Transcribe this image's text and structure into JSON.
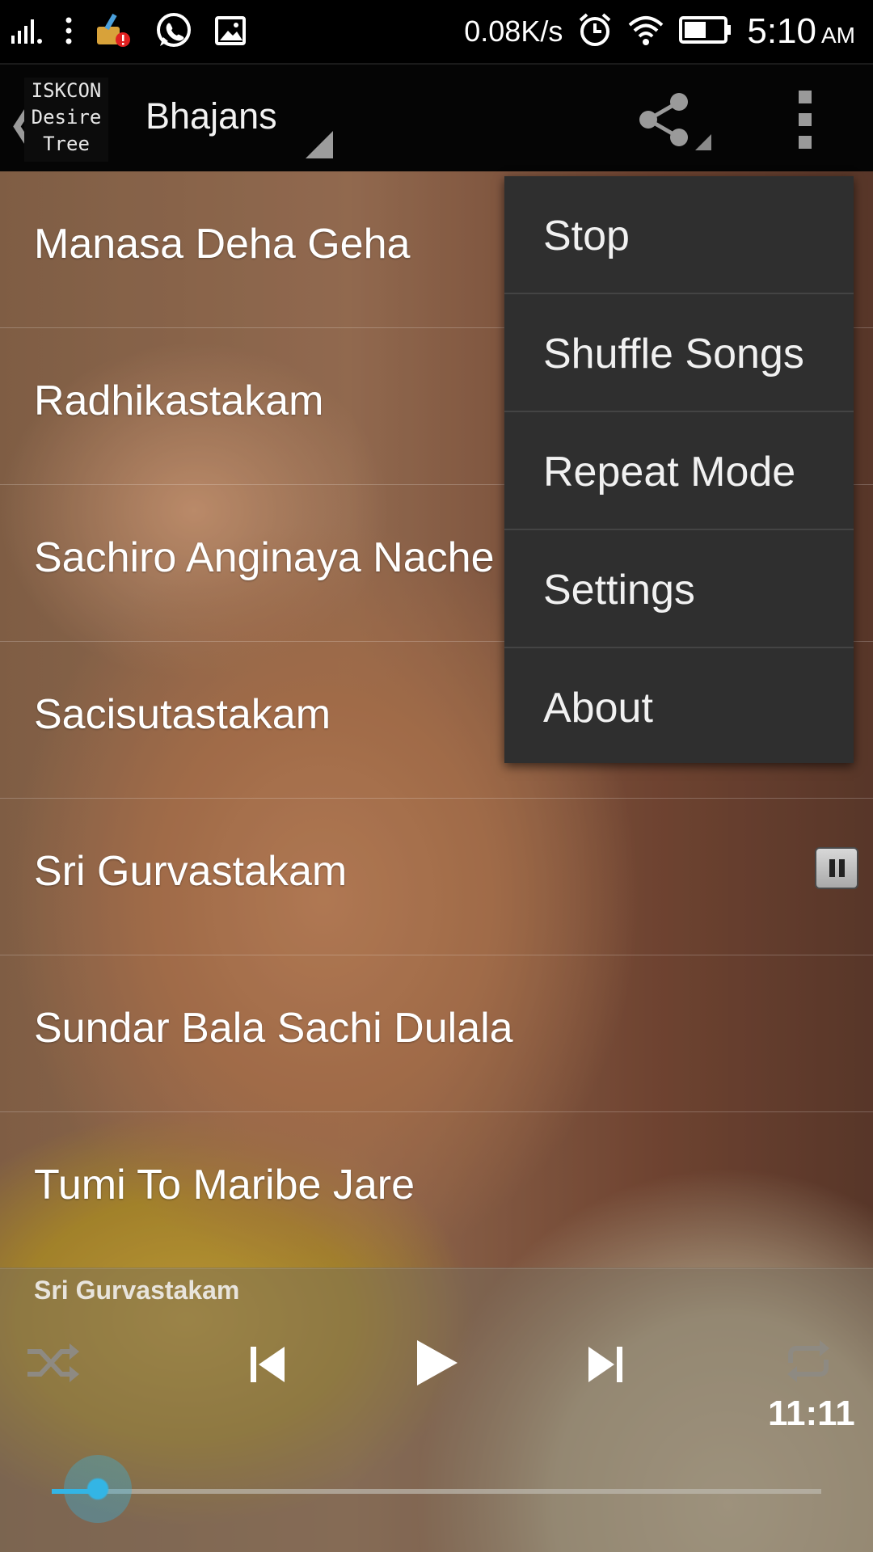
{
  "status_bar": {
    "net_speed": "0.08K/s",
    "time": "5:10",
    "ampm": "AM"
  },
  "action_bar": {
    "logo_lines": [
      "ISKCON",
      "Desire",
      "Tree"
    ],
    "title": "Bhajans"
  },
  "songs": [
    {
      "title": "Manasa Deha Geha"
    },
    {
      "title": "Radhikastakam"
    },
    {
      "title": "Sachiro Anginaya Nache"
    },
    {
      "title": "Sacisutastakam"
    },
    {
      "title": "Sri Gurvastakam",
      "playing": true
    },
    {
      "title": "Sundar Bala Sachi Dulala"
    },
    {
      "title": "Tumi To Maribe Jare"
    }
  ],
  "menu": {
    "items": [
      "Stop",
      "Shuffle Songs",
      "Repeat Mode",
      "Settings",
      "About"
    ]
  },
  "player": {
    "now_playing": "Sri Gurvastakam",
    "duration": "11:11",
    "progress_fraction": 0.06
  },
  "colors": {
    "accent": "#33b5e5",
    "menu_bg": "#2f2f2f",
    "action_bar_bg": "#050505"
  },
  "icons": {
    "status_left": [
      "signal-icon",
      "more-vert-icon",
      "cleaner-icon",
      "whatsapp-icon",
      "gallery-icon"
    ],
    "status_right": [
      "alarm-icon",
      "wifi-icon",
      "battery-icon"
    ],
    "player": [
      "shuffle-icon",
      "previous-icon",
      "play-icon",
      "next-icon",
      "repeat-icon"
    ]
  }
}
